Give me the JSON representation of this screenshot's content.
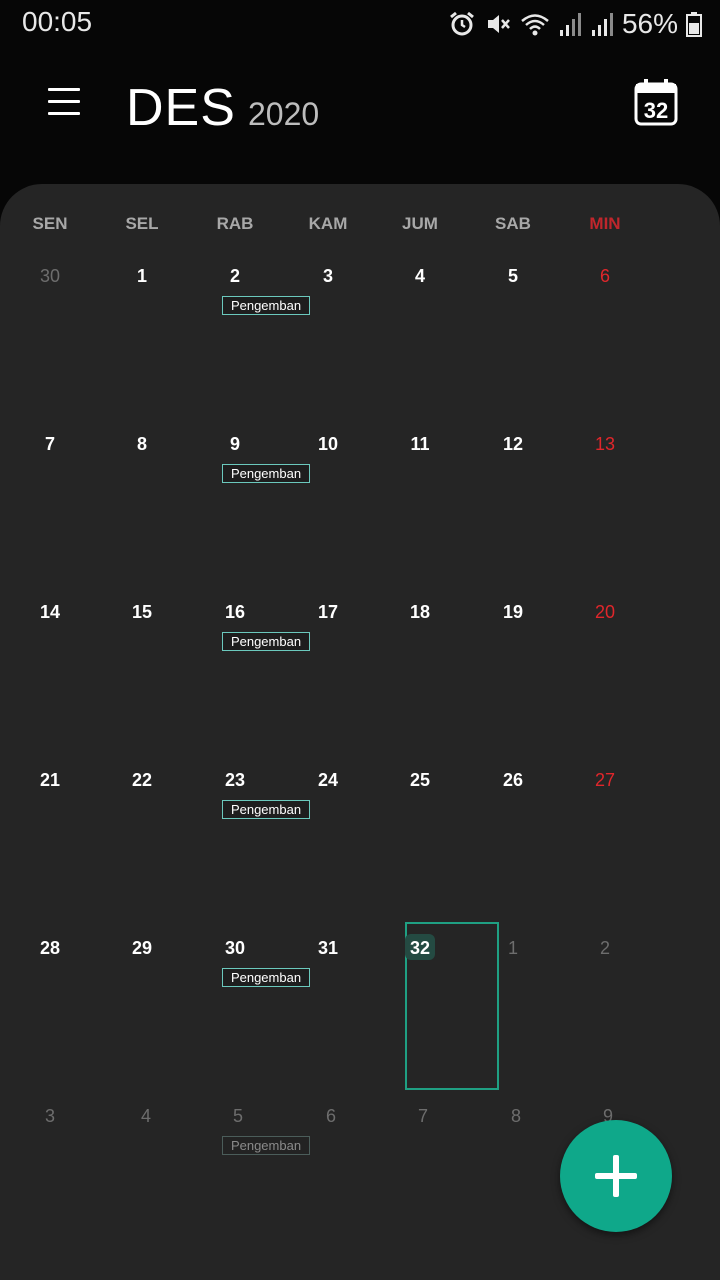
{
  "status_bar": {
    "time": "00:05",
    "battery_percent": "56%",
    "icons": [
      "alarm-icon",
      "mute-icon",
      "wifi-icon",
      "signal-icon",
      "signal-icon",
      "battery-icon"
    ]
  },
  "header": {
    "month": "DES",
    "year": "2020",
    "menu_icon": "hamburger-menu-icon",
    "today_icon": "calendar-today-icon",
    "today_icon_number": "32"
  },
  "weekdays": [
    "SEN",
    "SEL",
    "RAB",
    "KAM",
    "JUM",
    "SAB",
    "MIN"
  ],
  "weeks": [
    [
      "30",
      "1",
      "2",
      "3",
      "4",
      "5",
      "6"
    ],
    [
      "7",
      "8",
      "9",
      "10",
      "11",
      "12",
      "13"
    ],
    [
      "14",
      "15",
      "16",
      "17",
      "18",
      "19",
      "20"
    ],
    [
      "21",
      "22",
      "23",
      "24",
      "25",
      "26",
      "27"
    ],
    [
      "28",
      "29",
      "30",
      "31",
      "32",
      "1",
      "2"
    ],
    [
      "3",
      "4",
      "5",
      "6",
      "7",
      "8",
      "9"
    ]
  ],
  "event_label": "Pengemban",
  "today_label": "32",
  "fab_icon": "plus-icon",
  "colors": {
    "background": "#060606",
    "card": "#252525",
    "sunday": "#e0262b",
    "accent": "#0fa88a",
    "event_border": "#6bc9bd",
    "selection": "#1fa083"
  }
}
